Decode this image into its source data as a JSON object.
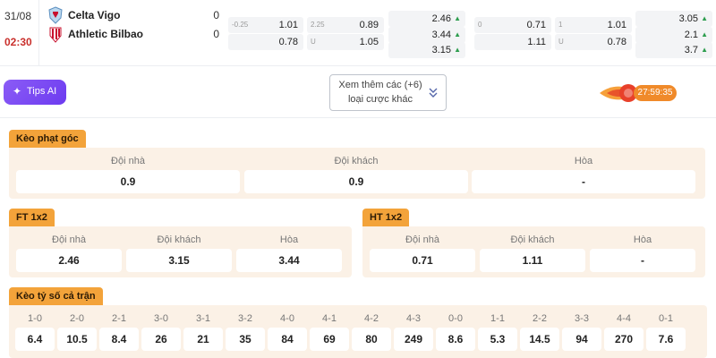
{
  "match": {
    "date": "31/08",
    "time": "02:30",
    "home_team": "Celta Vigo",
    "home_score": "0",
    "away_team": "Athletic Bilbao",
    "away_score": "0"
  },
  "odds": {
    "ft_handicap": {
      "home_line": "-0.25",
      "home": "1.01",
      "away": "0.78"
    },
    "ft_overunder": {
      "line": "2.25",
      "over": "0.89",
      "under_label": "U",
      "under": "1.05"
    },
    "ft_1x2": {
      "home": "2.46",
      "draw": "3.44",
      "away": "3.15"
    },
    "ht_handicap": {
      "home_line": "0",
      "home": "0.71",
      "away": "1.11"
    },
    "ht_overunder": {
      "line": "1",
      "over": "1.01",
      "under_label": "U",
      "under": "0.78"
    },
    "ht_1x2": {
      "home": "3.05",
      "draw": "2.1",
      "away": "3.7"
    },
    "up_arrow": "▲"
  },
  "toolbar": {
    "tips_label": "Tips AI",
    "tips_icon": "sparkle-icon",
    "more_line1": "Xem thêm các (+6)",
    "more_line2": "loại cược khác",
    "timer": "27:59:35"
  },
  "corners": {
    "title": "Kèo phạt góc",
    "columns": [
      "Đội nhà",
      "Đội khách",
      "Hòa"
    ],
    "values": [
      "0.9",
      "0.9",
      "-"
    ]
  },
  "ft1x2": {
    "title": "FT 1x2",
    "columns": [
      "Đội nhà",
      "Đội khách",
      "Hòa"
    ],
    "values": [
      "2.46",
      "3.15",
      "3.44"
    ]
  },
  "ht1x2": {
    "title": "HT 1x2",
    "columns": [
      "Đội nhà",
      "Đội khách",
      "Hòa"
    ],
    "values": [
      "0.71",
      "1.11",
      "-"
    ]
  },
  "correct_score": {
    "title": "Kèo tỷ số cả trận",
    "scores": [
      "1-0",
      "2-0",
      "2-1",
      "3-0",
      "3-1",
      "3-2",
      "4-0",
      "4-1",
      "4-2",
      "4-3",
      "0-0",
      "1-1",
      "2-2",
      "3-3",
      "4-4",
      "0-1"
    ],
    "odds": [
      "6.4",
      "10.5",
      "8.4",
      "26",
      "21",
      "35",
      "84",
      "69",
      "80",
      "249",
      "8.6",
      "5.3",
      "14.5",
      "94",
      "270",
      "7.6"
    ]
  },
  "colors": {
    "accent_orange": "#f3a33a",
    "panel_bg": "#fbf1e6",
    "time_red": "#c9302c",
    "odds_up_green": "#2e9e4f",
    "tips_purple": "#7c4dff"
  }
}
